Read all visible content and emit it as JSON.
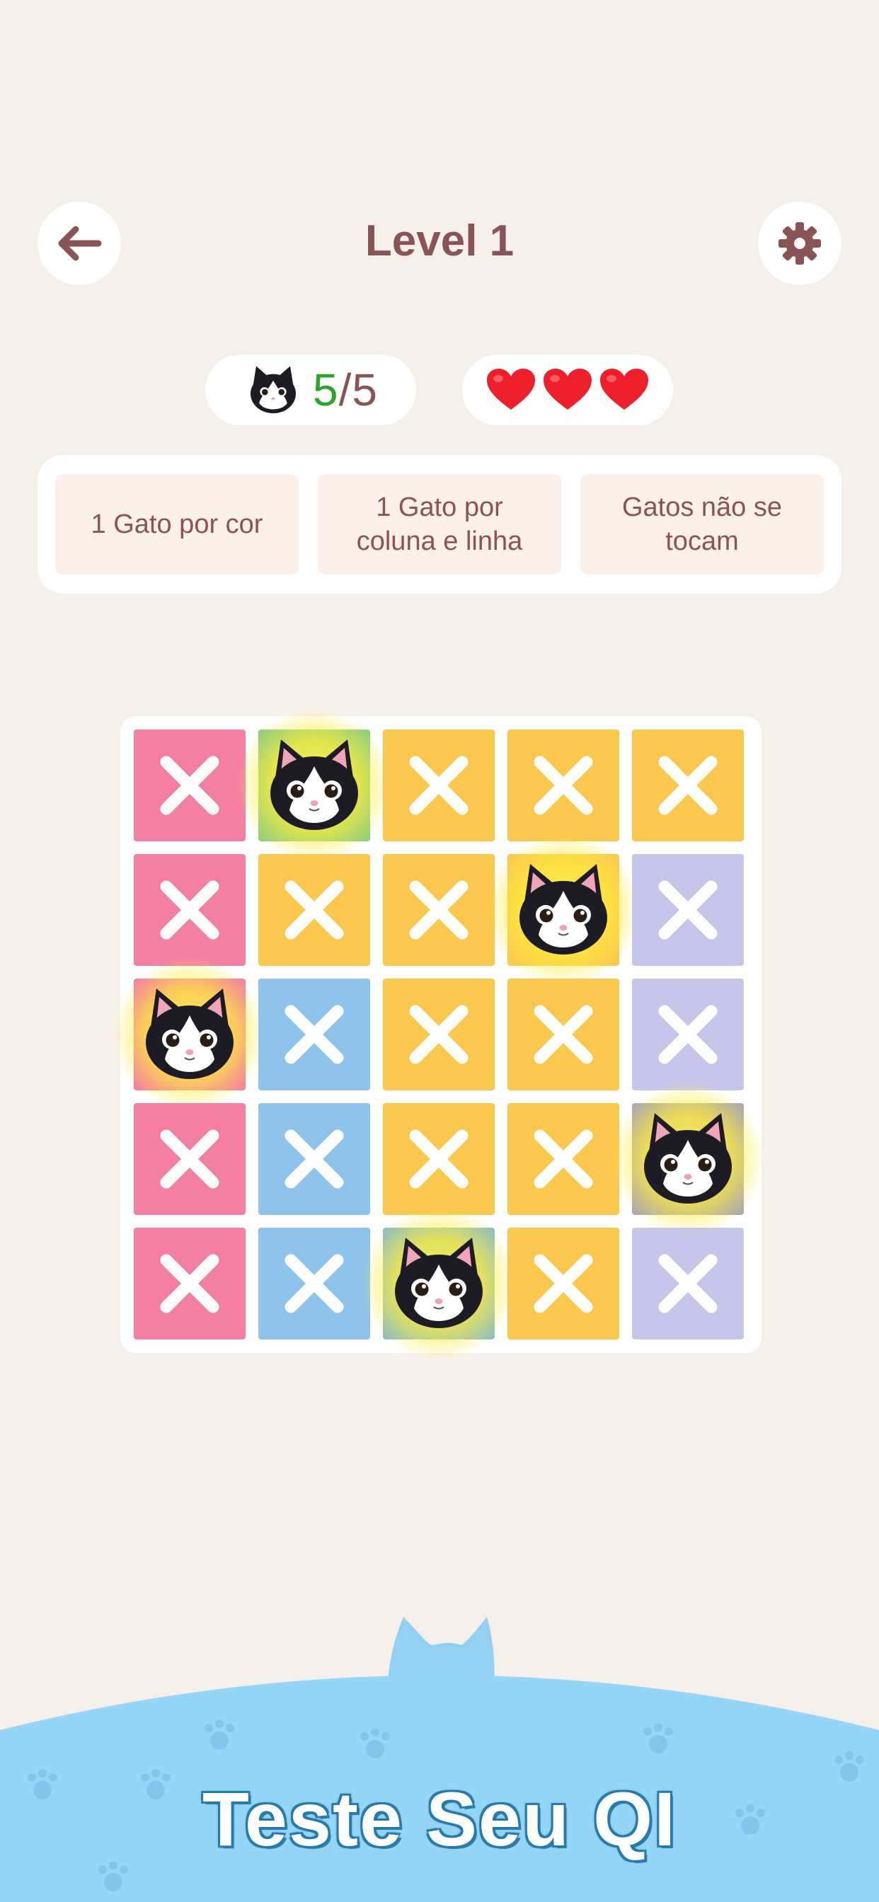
{
  "header": {
    "title": "Level 1",
    "back_icon": "arrow-left-icon",
    "settings_icon": "gear-icon"
  },
  "counter": {
    "found": "5",
    "separator": "/",
    "total": "5"
  },
  "lives": {
    "count": 3,
    "icon": "heart-icon"
  },
  "rules": [
    {
      "label": "1 Gato por cor"
    },
    {
      "label": "1 Gato por\ncoluna e linha"
    },
    {
      "label": "Gatos não se\ntocam"
    }
  ],
  "colors": {
    "pink": "#f47fa3",
    "green": "#8fcf7c",
    "yellow": "#fbc74d",
    "lavender": "#c6c6ea",
    "blue": "#8ec4ec",
    "gray": "#aba8ae",
    "teal": "#8fc0c0"
  },
  "board": {
    "rows": [
      [
        {
          "color": "pink",
          "state": "x"
        },
        {
          "color": "green",
          "state": "cat"
        },
        {
          "color": "yellow",
          "state": "x"
        },
        {
          "color": "yellow",
          "state": "x"
        },
        {
          "color": "yellow",
          "state": "x"
        }
      ],
      [
        {
          "color": "pink",
          "state": "x"
        },
        {
          "color": "yellow",
          "state": "x"
        },
        {
          "color": "yellow",
          "state": "x"
        },
        {
          "color": "yellow",
          "state": "cat"
        },
        {
          "color": "lavender",
          "state": "x"
        }
      ],
      [
        {
          "color": "pink",
          "state": "cat"
        },
        {
          "color": "blue",
          "state": "x"
        },
        {
          "color": "yellow",
          "state": "x"
        },
        {
          "color": "yellow",
          "state": "x"
        },
        {
          "color": "lavender",
          "state": "x"
        }
      ],
      [
        {
          "color": "pink",
          "state": "x"
        },
        {
          "color": "blue",
          "state": "x"
        },
        {
          "color": "yellow",
          "state": "x"
        },
        {
          "color": "yellow",
          "state": "x"
        },
        {
          "color": "gray",
          "state": "cat"
        }
      ],
      [
        {
          "color": "pink",
          "state": "x"
        },
        {
          "color": "blue",
          "state": "x"
        },
        {
          "color": "teal",
          "state": "cat"
        },
        {
          "color": "yellow",
          "state": "x"
        },
        {
          "color": "lavender",
          "state": "x"
        }
      ]
    ]
  },
  "banner": {
    "title": "Teste Seu QI"
  }
}
